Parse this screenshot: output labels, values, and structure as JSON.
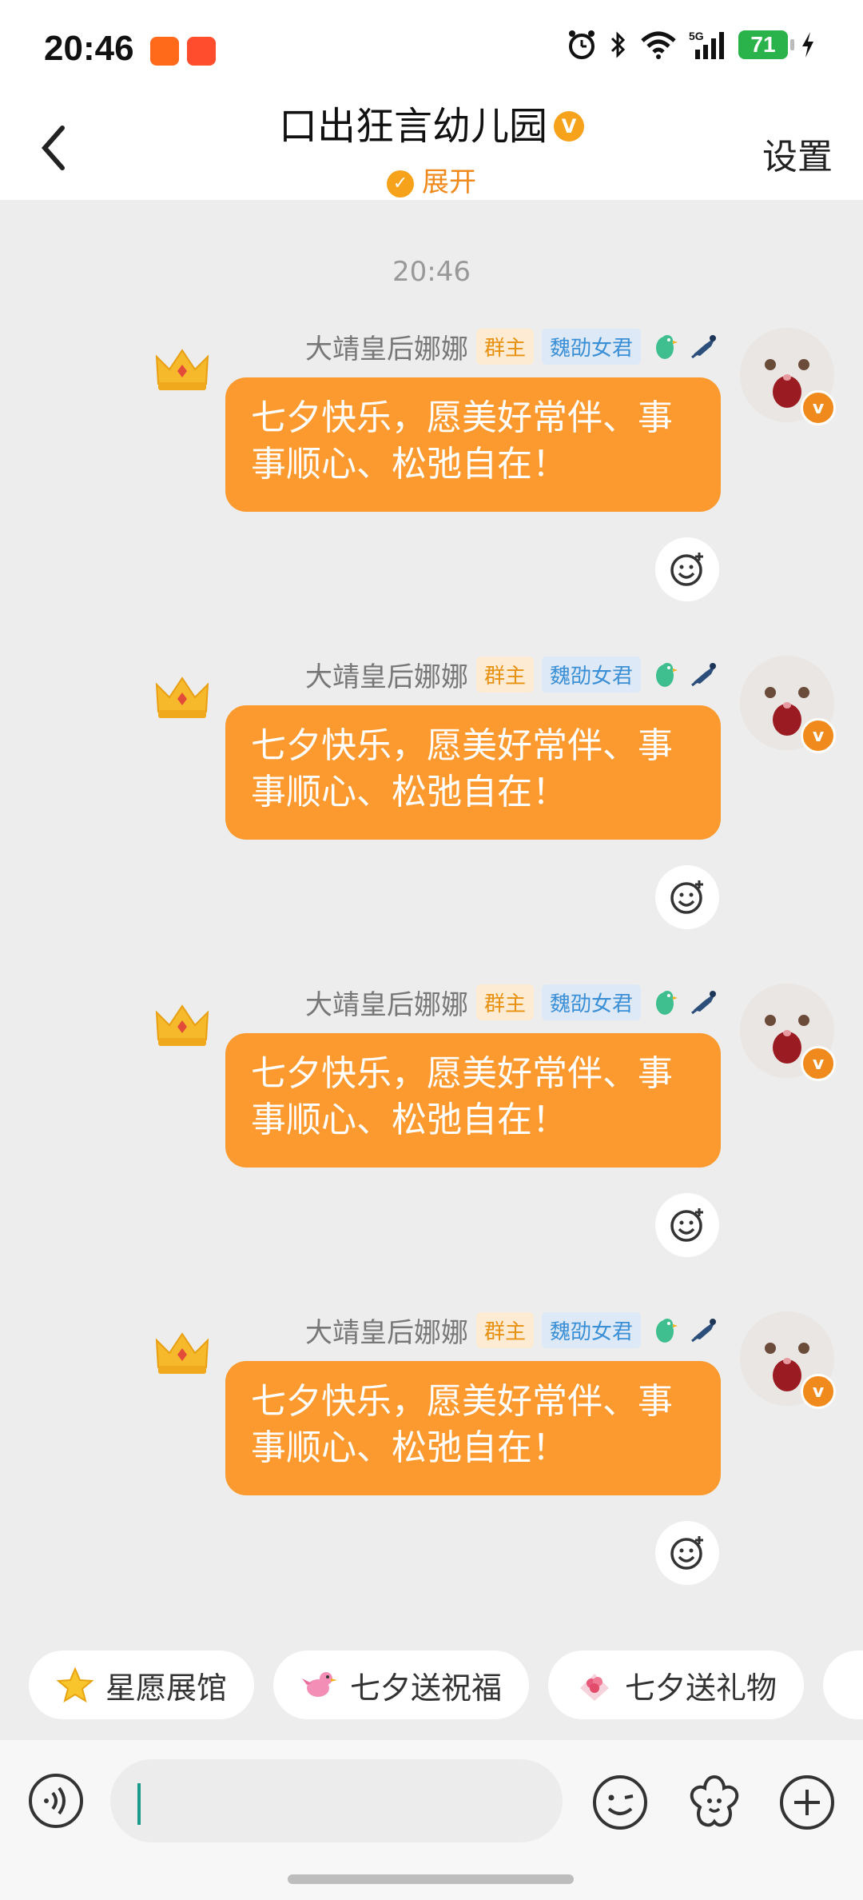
{
  "status_bar": {
    "time": "20:46",
    "battery": "71",
    "signal_label": "5G"
  },
  "header": {
    "title": "口出狂言幼儿园",
    "title_badge": "V",
    "expand_label": "展开",
    "settings_label": "设置",
    "back_icon": "chevron-left-icon"
  },
  "chat": {
    "timestamp": "20:46",
    "messages": [
      {
        "sender": "大靖皇后娜娜",
        "owner_tag": "群主",
        "title_tag": "魏劭女君",
        "text": "七夕快乐，愿美好常伴、事事顺心、松弛自在！"
      },
      {
        "sender": "大靖皇后娜娜",
        "owner_tag": "群主",
        "title_tag": "魏劭女君",
        "text": "七夕快乐，愿美好常伴、事事顺心、松弛自在！"
      },
      {
        "sender": "大靖皇后娜娜",
        "owner_tag": "群主",
        "title_tag": "魏劭女君",
        "text": "七夕快乐，愿美好常伴、事事顺心、松弛自在！"
      },
      {
        "sender": "大靖皇后娜娜",
        "owner_tag": "群主",
        "title_tag": "魏劭女君",
        "text": "七夕快乐，愿美好常伴、事事顺心、松弛自在！"
      }
    ]
  },
  "quick_actions": [
    {
      "label": "星愿展馆",
      "icon": "star-icon"
    },
    {
      "label": "七夕送祝福",
      "icon": "bird-icon"
    },
    {
      "label": "七夕送礼物",
      "icon": "gift-icon"
    }
  ],
  "input": {
    "value": "",
    "voice_icon": "voice-icon",
    "emoji_icon": "emoji-icon",
    "sticker_icon": "flower-icon",
    "plus_icon": "plus-icon"
  },
  "colors": {
    "bubble": "#fd9a2f",
    "accent": "#f08a1c",
    "owner_tag": "#e8900f",
    "title_tag": "#3a8fd6"
  }
}
